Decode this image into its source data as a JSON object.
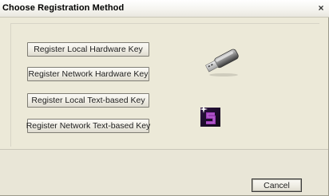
{
  "window": {
    "title": "Choose Registration Method",
    "close_label": "×"
  },
  "buttons": {
    "local_hardware": "Register Local Hardware Key",
    "network_hardware": "Register Network Hardware Key",
    "local_text": "Register Local Text-based Key",
    "network_text": "Register Network Text-based Key"
  },
  "footer": {
    "cancel_label": "Cancel"
  },
  "icons": {
    "hardware": "usb-key-icon",
    "text": "s-logo-icon"
  },
  "colors": {
    "dialog_bg": "#ece9d8",
    "logo_purple": "#7a2a8c"
  }
}
